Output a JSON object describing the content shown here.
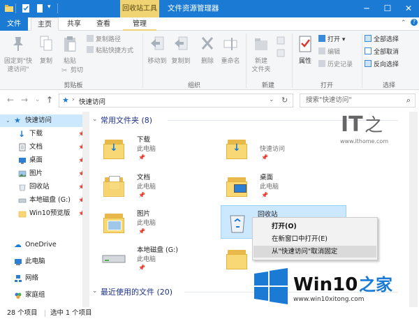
{
  "window": {
    "title": "文件资源管理器",
    "context_tab_title": "回收站工具",
    "accent": "#1a7ad4",
    "context_accent": "#f0d373"
  },
  "tabs": [
    {
      "label": "文件"
    },
    {
      "label": "主页"
    },
    {
      "label": "共享"
    },
    {
      "label": "查看"
    },
    {
      "label": "管理"
    }
  ],
  "ribbon": {
    "clipboard": {
      "pin_quick_access": "固定到\"快\n速访问\"",
      "copy": "复制",
      "paste": "粘贴",
      "copy_path": "复制路径",
      "paste_shortcut": "粘贴快捷方式",
      "cut": "剪切",
      "group_label": "剪贴板"
    },
    "organize": {
      "move_to": "移动到",
      "copy_to": "复制到",
      "delete": "删除",
      "rename": "重命名",
      "group_label": "组织"
    },
    "new": {
      "new_folder": "新建\n文件夹",
      "group_label": "新建"
    },
    "open": {
      "properties": "属性",
      "open": "打开",
      "edit": "编辑",
      "history": "历史记录",
      "group_label": "打开"
    },
    "select": {
      "select_all": "全部选择",
      "select_none": "全部取消",
      "invert": "反向选择",
      "group_label": "选择"
    }
  },
  "address": {
    "path": "快速访问",
    "search_placeholder": "搜索\"快速访问\""
  },
  "nav": [
    {
      "label": "快速访问",
      "icon": "star-icon",
      "pinned": false
    },
    {
      "label": "下载",
      "icon": "download-icon",
      "pinned": true
    },
    {
      "label": "文档",
      "icon": "document-icon",
      "pinned": true
    },
    {
      "label": "桌面",
      "icon": "desktop-icon",
      "pinned": true
    },
    {
      "label": "图片",
      "icon": "picture-icon",
      "pinned": true
    },
    {
      "label": "回收站",
      "icon": "recycle-bin-icon",
      "pinned": true
    },
    {
      "label": "本地磁盘 (G:)",
      "icon": "drive-icon",
      "pinned": true
    },
    {
      "label": "Win10预览版",
      "icon": "folder-icon",
      "pinned": true
    },
    {
      "label": "OneDrive",
      "icon": "cloud-icon",
      "pinned": false
    },
    {
      "label": "此电脑",
      "icon": "computer-icon",
      "pinned": false
    },
    {
      "label": "网络",
      "icon": "network-icon",
      "pinned": false
    },
    {
      "label": "家庭组",
      "icon": "homegroup-icon",
      "pinned": false
    }
  ],
  "main": {
    "frequent_header": "常用文件夹 (8)",
    "recent_header": "最近使用的文件 (20)",
    "tiles": [
      {
        "name": "下载",
        "sub": "此电脑",
        "icon": "download-folder-icon"
      },
      {
        "name": "",
        "sub": "快速访问",
        "icon": "download-folder-icon"
      },
      {
        "name": "文档",
        "sub": "此电脑",
        "icon": "document-folder-icon"
      },
      {
        "name": "桌面",
        "sub": "此电脑",
        "icon": "desktop-folder-icon"
      },
      {
        "name": "图片",
        "sub": "此电脑",
        "icon": "picture-folder-icon"
      },
      {
        "name": "回收站",
        "sub": "",
        "icon": "recycle-bin-icon"
      },
      {
        "name": "本地磁盘 (G:)",
        "sub": "此电脑",
        "icon": "drive-icon"
      },
      {
        "name": "",
        "sub": "",
        "icon": "folder-icon"
      }
    ]
  },
  "context_menu": [
    {
      "label": "打开(O)",
      "bold": true
    },
    {
      "label": "在新窗口中打开(E)",
      "bold": false
    },
    {
      "label": "从\"快速访问\"取消固定",
      "bold": false
    }
  ],
  "status": {
    "count": "28 个项目",
    "selected": "选中 1 个项目"
  },
  "watermark": {
    "ithome_logo": "IT之家",
    "ithome_url": "www.ithome.com",
    "win10_logo": "Win10 之家",
    "win10_url": "www.win10xitong.com"
  }
}
